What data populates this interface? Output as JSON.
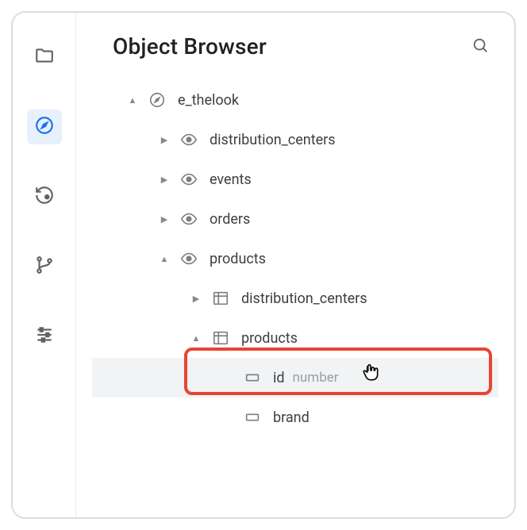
{
  "header": {
    "title": "Object Browser"
  },
  "rail": {
    "items": [
      {
        "name": "folder-icon"
      },
      {
        "name": "compass-icon"
      },
      {
        "name": "history-icon"
      },
      {
        "name": "branch-icon"
      },
      {
        "name": "filter-icon"
      }
    ]
  },
  "tree": {
    "root": {
      "label": "e_thelook"
    },
    "views": {
      "distribution_centers": {
        "label": "distribution_centers"
      },
      "events": {
        "label": "events"
      },
      "orders": {
        "label": "orders"
      },
      "products": {
        "label": "products"
      }
    },
    "tables": {
      "distribution_centers": {
        "label": "distribution_centers"
      },
      "products": {
        "label": "products"
      }
    },
    "fields": {
      "id": {
        "label": "id",
        "type": "number"
      },
      "brand": {
        "label": "brand"
      }
    }
  }
}
